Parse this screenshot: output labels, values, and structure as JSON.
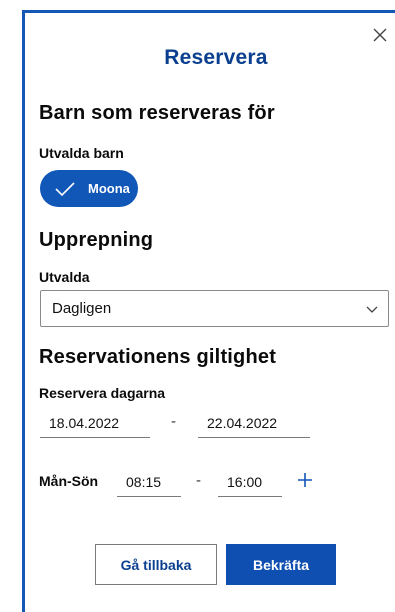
{
  "modal": {
    "title": "Reservera",
    "close_icon": "close-icon"
  },
  "children_section": {
    "heading": "Barn som reserveras för",
    "label": "Utvalda barn",
    "chips": [
      {
        "label": "Moona",
        "selected": true,
        "icon": "check-icon"
      }
    ]
  },
  "repeat_section": {
    "heading": "Upprepning",
    "label": "Utvalda",
    "selected_value": "Dagligen",
    "caret_icon": "chevron-down-icon"
  },
  "validity_section": {
    "heading": "Reservationens giltighet",
    "label": "Reservera dagarna",
    "start_date": "18.04.2022",
    "dash": "-",
    "end_date": "22.04.2022",
    "day_range_label": "Mån-Sön",
    "start_time": "08:15",
    "time_dash": "-",
    "end_time": "16:00",
    "add_icon": "plus-icon"
  },
  "actions": {
    "back_label": "Gå tillbaka",
    "confirm_label": "Bekräfta"
  },
  "colors": {
    "accent": "#1157b8",
    "title": "#0b3f8f",
    "border": "#1458b6"
  }
}
